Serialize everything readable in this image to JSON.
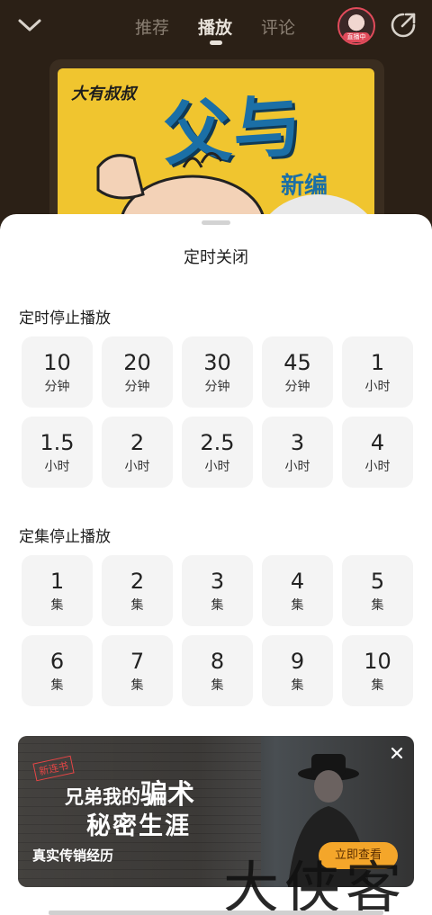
{
  "header": {
    "tabs": [
      {
        "label": "推荐",
        "active": false
      },
      {
        "label": "播放",
        "active": true
      },
      {
        "label": "评论",
        "active": false
      }
    ],
    "avatar_badge": "直播中",
    "icons": {
      "back": "chevron-down-icon",
      "share": "share-icon"
    }
  },
  "cover": {
    "brand": "大有叔叔",
    "title": "父与子",
    "subtitle": "新编"
  },
  "sheet": {
    "title": "定时关闭",
    "timer_section": {
      "title": "定时停止播放",
      "options": [
        {
          "num": "10",
          "unit": "分钟"
        },
        {
          "num": "20",
          "unit": "分钟"
        },
        {
          "num": "30",
          "unit": "分钟"
        },
        {
          "num": "45",
          "unit": "分钟"
        },
        {
          "num": "1",
          "unit": "小时"
        },
        {
          "num": "1.5",
          "unit": "小时"
        },
        {
          "num": "2",
          "unit": "小时"
        },
        {
          "num": "2.5",
          "unit": "小时"
        },
        {
          "num": "3",
          "unit": "小时"
        },
        {
          "num": "4",
          "unit": "小时"
        }
      ]
    },
    "episode_section": {
      "title": "定集停止播放",
      "options": [
        {
          "num": "1",
          "unit": "集"
        },
        {
          "num": "2",
          "unit": "集"
        },
        {
          "num": "3",
          "unit": "集"
        },
        {
          "num": "4",
          "unit": "集"
        },
        {
          "num": "5",
          "unit": "集"
        },
        {
          "num": "6",
          "unit": "集"
        },
        {
          "num": "7",
          "unit": "集"
        },
        {
          "num": "8",
          "unit": "集"
        },
        {
          "num": "9",
          "unit": "集"
        },
        {
          "num": "10",
          "unit": "集"
        }
      ]
    }
  },
  "ad": {
    "stamp": "新连书",
    "title_line1_prefix": "兄弟我的",
    "title_line1_highlight": "骗术",
    "title_line2": "秘密生涯",
    "subtitle": "真实传销经历",
    "cta": "立即查看",
    "close_icon": "close-icon"
  },
  "watermark": "大侠客",
  "colors": {
    "background": "#2b2016",
    "sheet": "#ffffff",
    "option_bg": "#f4f4f4",
    "accent_avatar": "#e24b5b",
    "cta": "#f4a62a",
    "cover_bg": "#f0c52f",
    "cover_title": "#1b6fa6"
  }
}
